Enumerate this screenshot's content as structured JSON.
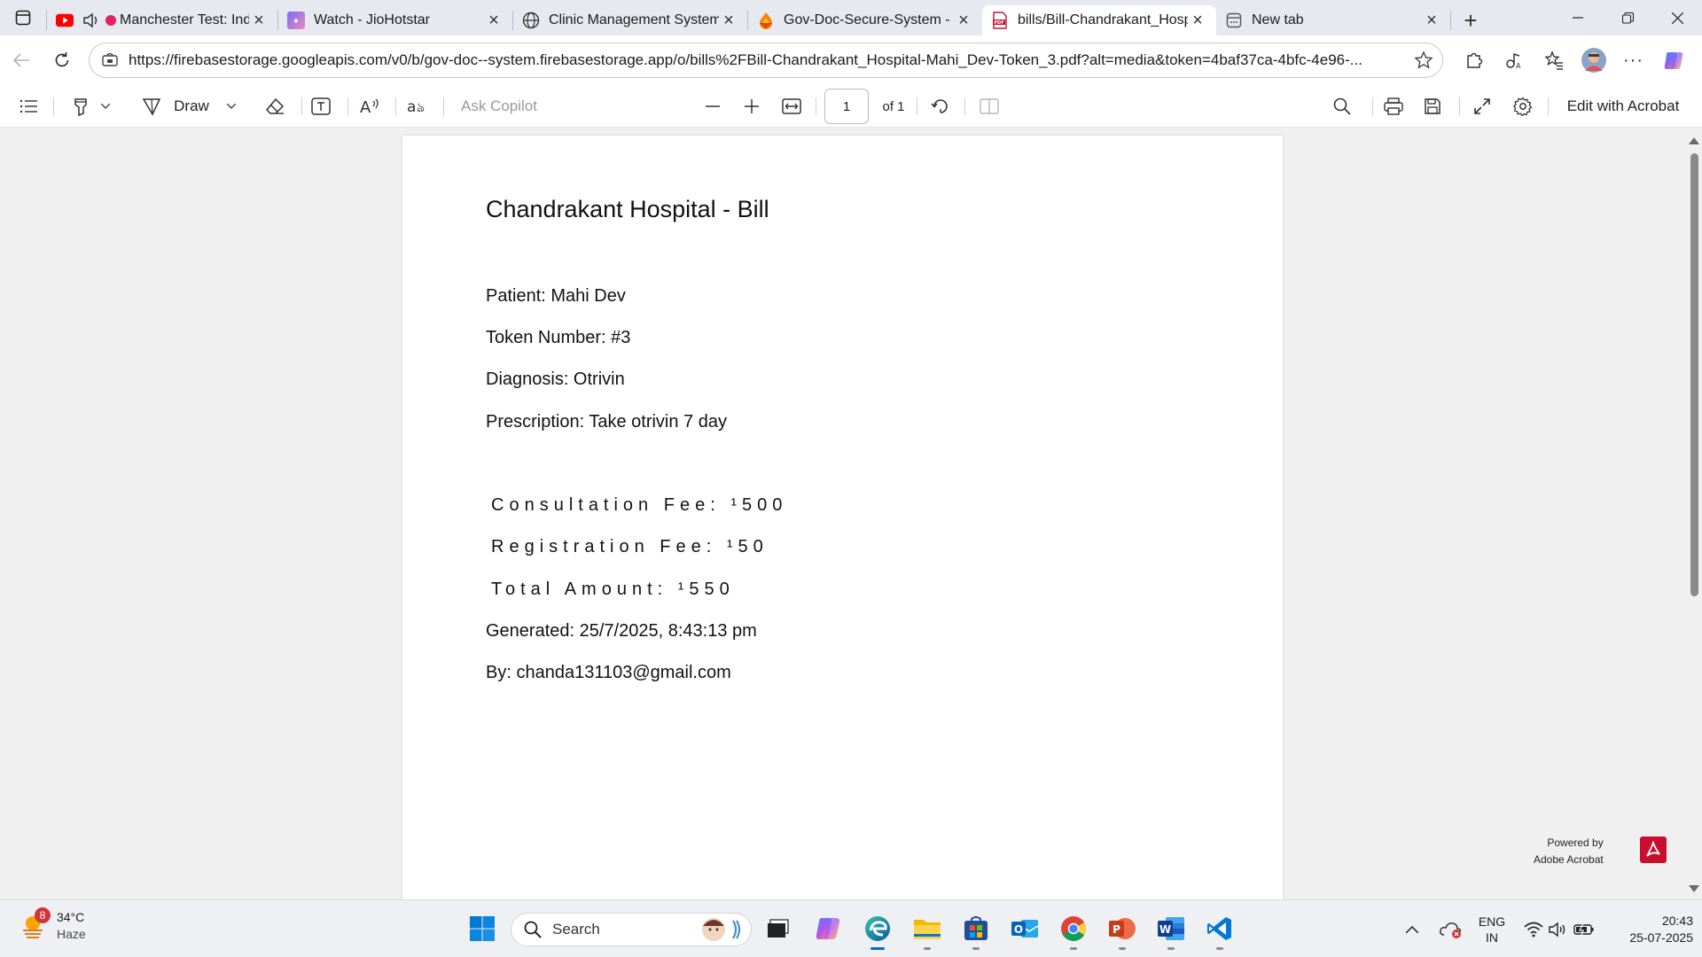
{
  "tabs": [
    {
      "title": "Manchester Test: Ind",
      "icon": "youtube-icon"
    },
    {
      "title": "Watch - JioHotstar",
      "icon": "hotstar-icon"
    },
    {
      "title": "Clinic Management System",
      "icon": "globe-icon"
    },
    {
      "title": "Gov-Doc-Secure-System - St",
      "icon": "firebase-icon"
    },
    {
      "title": "bills/Bill-Chandrakant_Hospi",
      "icon": "pdf-icon"
    },
    {
      "title": "New tab",
      "icon": "newtab-icon"
    }
  ],
  "active_tab_index": 4,
  "address": {
    "url": "https://firebasestorage.googleapis.com/v0/b/gov-doc--system.firebasestorage.app/o/bills%2FBill-Chandrakant_Hospital-Mahi_Dev-Token_3.pdf?alt=media&token=4baf37ca-4bfc-4e96-..."
  },
  "pdf_toolbar": {
    "draw_label": "Draw",
    "ask_copilot": "Ask Copilot",
    "page_current": "1",
    "page_total": "of 1",
    "edit_acrobat": "Edit with Acrobat"
  },
  "document": {
    "title": "Chandrakant Hospital - Bill",
    "patient": "Patient: Mahi Dev",
    "token": "Token Number: #3",
    "diagnosis": "Diagnosis: Otrivin",
    "prescription": "Prescription: Take otrivin 7 day",
    "consultation_fee": "Consultation Fee: ¹500",
    "registration_fee": "Registration Fee: ¹50",
    "total_amount": "Total Amount: ¹550",
    "generated": "Generated: 25/7/2025, 8:43:13 pm",
    "by": "By: chanda131103@gmail.com"
  },
  "powered_by": {
    "line1": "Powered by",
    "line2": "Adobe Acrobat"
  },
  "taskbar": {
    "weather_temp": "34°C",
    "weather_desc": "Haze",
    "weather_badge": "8",
    "search_label": "Search",
    "lang_line1": "ENG",
    "lang_line2": "IN",
    "time": "20:43",
    "date": "25-07-2025"
  },
  "colors": {
    "accent": "#0f6cbd",
    "youtube_red": "#ff0000",
    "acrobat_red": "#c8102e"
  }
}
